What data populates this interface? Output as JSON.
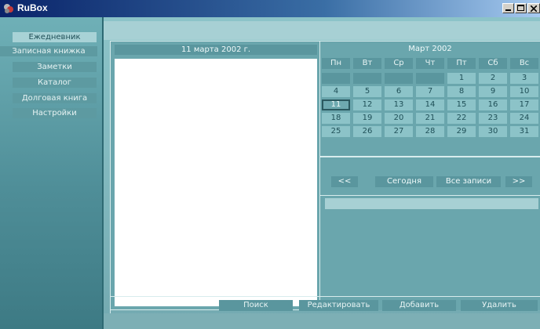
{
  "window": {
    "title": "RuBox"
  },
  "sidebar": {
    "items": [
      {
        "label": "Ежедневник",
        "active": true
      },
      {
        "label": "Записная книжка"
      },
      {
        "label": "Заметки"
      },
      {
        "label": "Каталог"
      },
      {
        "label": "Долговая книга"
      },
      {
        "label": "Настройки"
      }
    ]
  },
  "day_panel": {
    "date": "11 марта 2002 г.",
    "notes_text": ""
  },
  "calendar": {
    "month": "Март 2002",
    "weekdays": [
      "Пн",
      "Вт",
      "Ср",
      "Чт",
      "Пт",
      "Сб",
      "Вс"
    ],
    "weeks": [
      [
        "",
        "",
        "",
        "",
        "1",
        "2",
        "3"
      ],
      [
        "4",
        "5",
        "6",
        "7",
        "8",
        "9",
        "10"
      ],
      [
        "11",
        "12",
        "13",
        "14",
        "15",
        "16",
        "17"
      ],
      [
        "18",
        "19",
        "20",
        "21",
        "22",
        "23",
        "24"
      ],
      [
        "25",
        "26",
        "27",
        "28",
        "29",
        "30",
        "31"
      ]
    ],
    "selected_day": "11"
  },
  "nav": {
    "prev": "<<",
    "today": "Сегодня",
    "all": "Все записи",
    "next": ">>"
  },
  "bottom": {
    "search": "Поиск",
    "edit": "Редактировать",
    "add": "Добавить",
    "delete": "Удалить"
  }
}
